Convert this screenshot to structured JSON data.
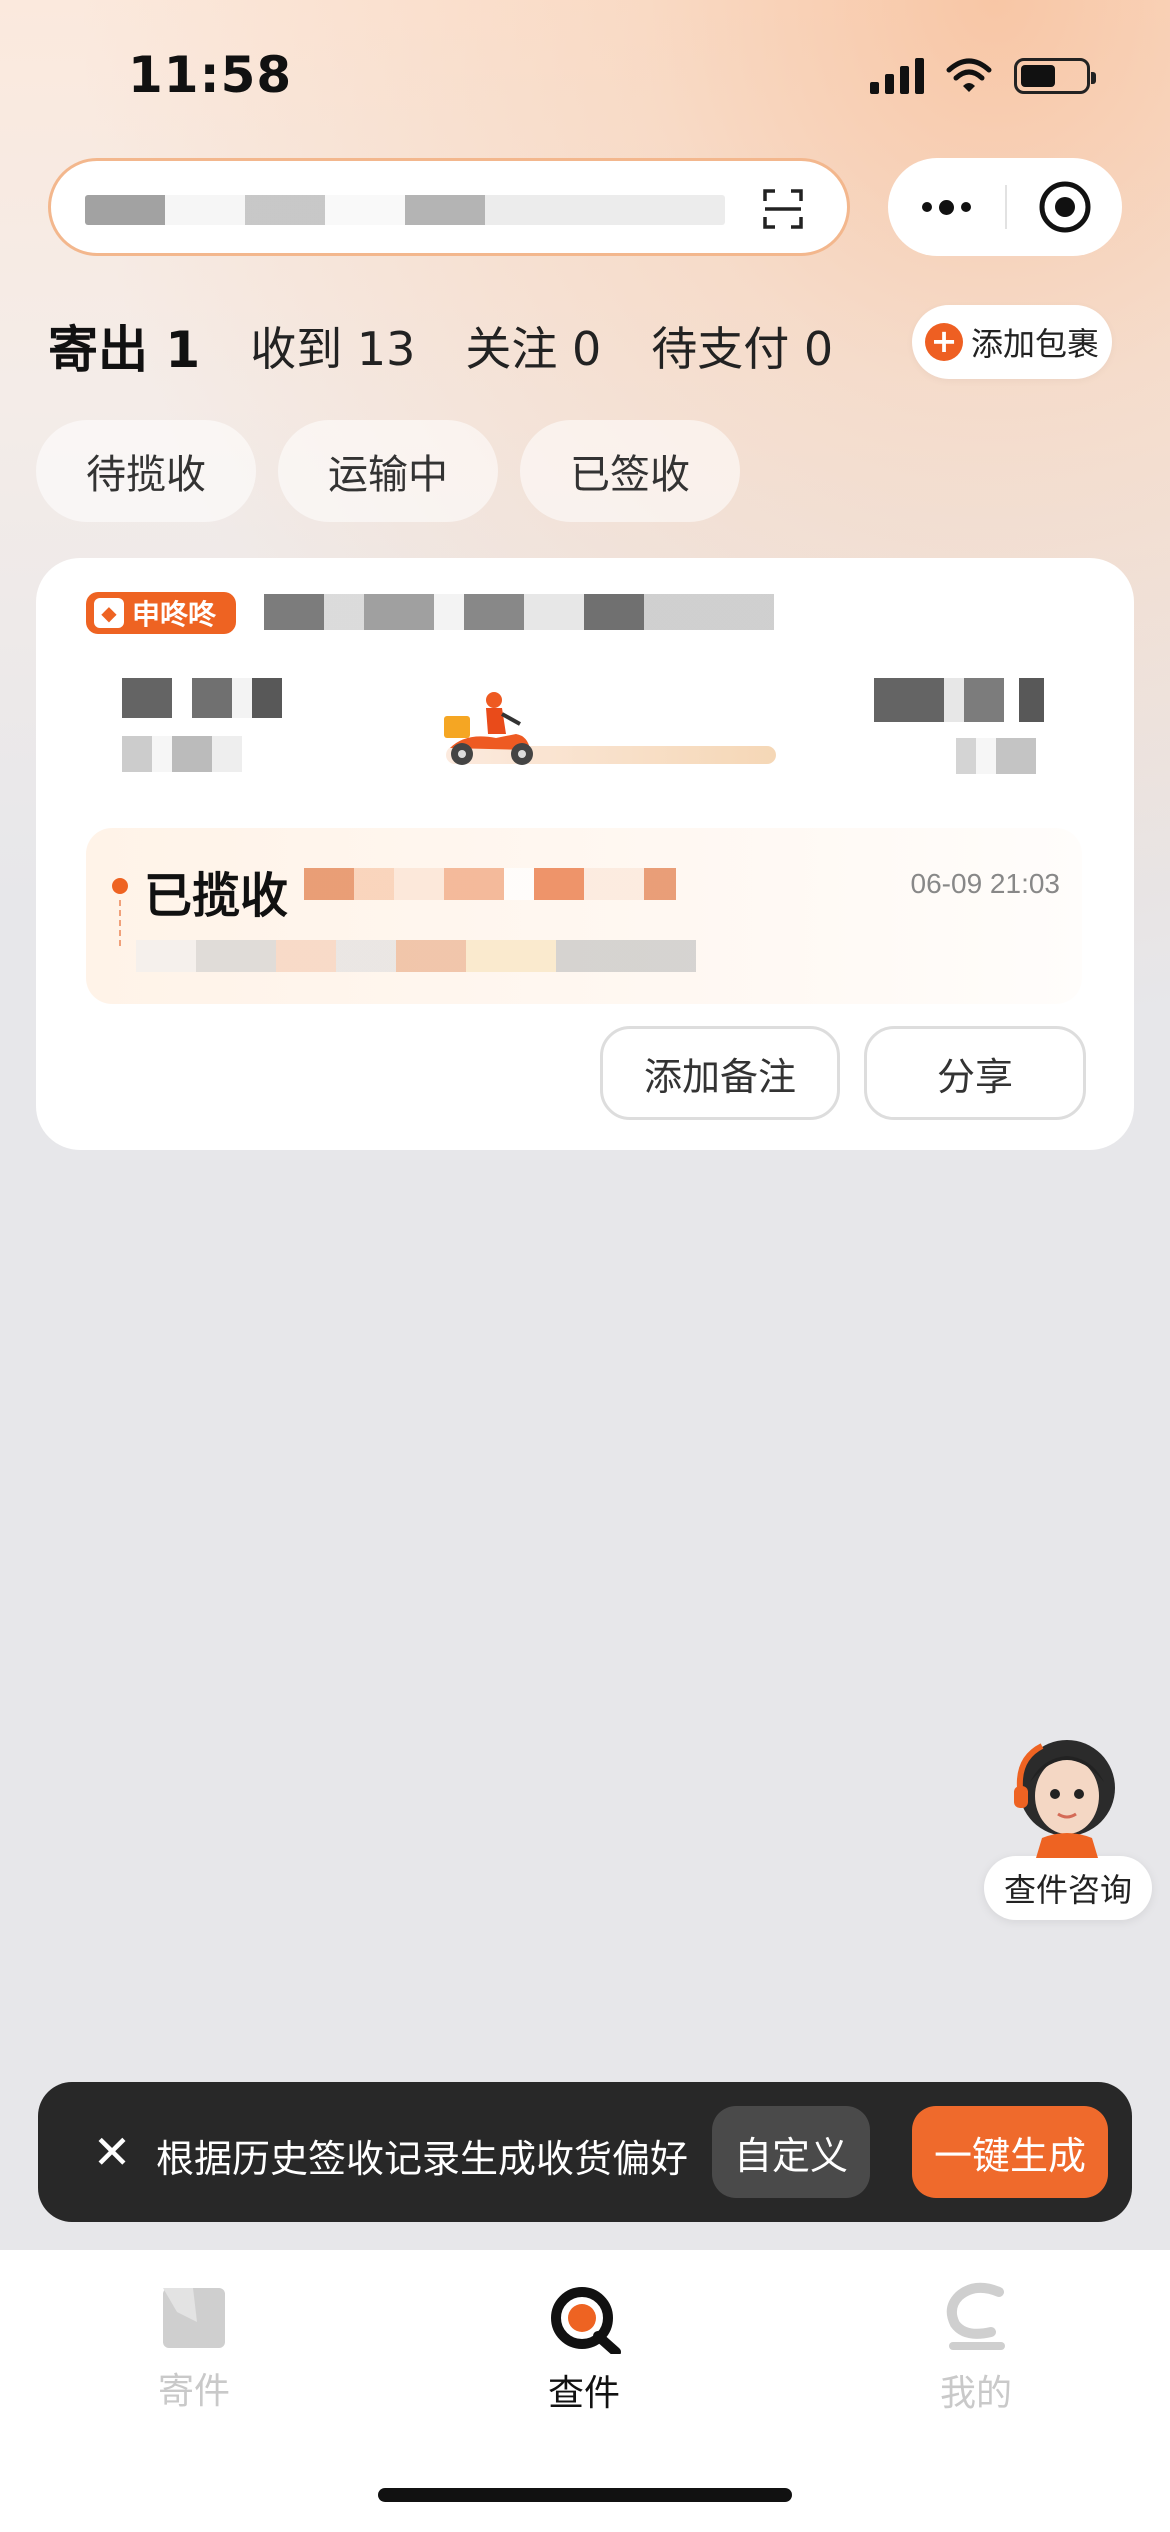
{
  "status_bar": {
    "time": "11:58"
  },
  "search": {
    "redacted": true
  },
  "tabs": [
    {
      "label": "寄出 1",
      "active": true
    },
    {
      "label": "收到 13",
      "active": false
    },
    {
      "label": "关注 0",
      "active": false
    },
    {
      "label": "待支付 0",
      "active": false
    }
  ],
  "add_package": {
    "label": "添加包裹",
    "icon": "plus-icon"
  },
  "filters": [
    "待揽收",
    "运输中",
    "已签收"
  ],
  "package_card": {
    "carrier": "申咚咚",
    "status": "已揽收",
    "time": "06-09 21:03",
    "buttons": {
      "remark": "添加备注",
      "share": "分享"
    }
  },
  "assistant": {
    "label": "查件咨询"
  },
  "banner": {
    "message": "根据历史签收记录生成收货偏好",
    "custom": "自定义",
    "generate": "一键生成"
  },
  "tabbar": [
    {
      "label": "寄件",
      "active": false
    },
    {
      "label": "查件",
      "active": true
    },
    {
      "label": "我的",
      "active": false
    }
  ],
  "colors": {
    "accent": "#ee6322",
    "banner_bg": "#282828",
    "inactive": "#c9c9c9"
  }
}
